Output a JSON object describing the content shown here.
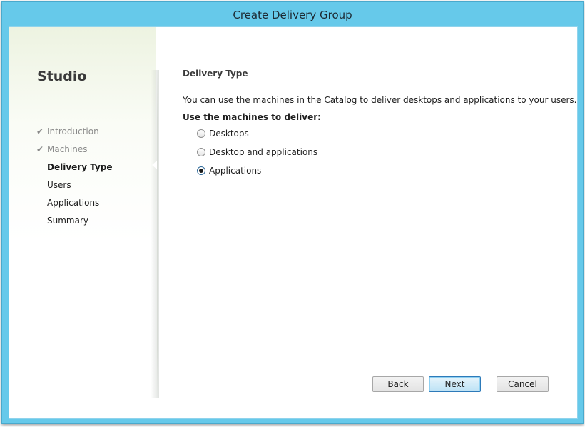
{
  "window": {
    "title": "Create Delivery Group"
  },
  "sidebar": {
    "heading": "Studio",
    "steps": [
      {
        "label": "Introduction",
        "state": "done"
      },
      {
        "label": "Machines",
        "state": "done"
      },
      {
        "label": "Delivery Type",
        "state": "current"
      },
      {
        "label": "Users",
        "state": "pending"
      },
      {
        "label": "Applications",
        "state": "pending"
      },
      {
        "label": "Summary",
        "state": "pending"
      }
    ],
    "check_glyph": "✔"
  },
  "content": {
    "title": "Delivery Type",
    "description": "You can use the machines in the Catalog to deliver desktops and applications to your users.",
    "options_label": "Use the machines to deliver:",
    "options": [
      {
        "label": "Desktops",
        "selected": false
      },
      {
        "label": "Desktop and applications",
        "selected": false
      },
      {
        "label": "Applications",
        "selected": true
      }
    ]
  },
  "buttons": {
    "back": "Back",
    "next": "Next",
    "cancel": "Cancel"
  },
  "colors": {
    "title_bar": "#66c9ea",
    "primary_button_border": "#2d7ab9"
  }
}
